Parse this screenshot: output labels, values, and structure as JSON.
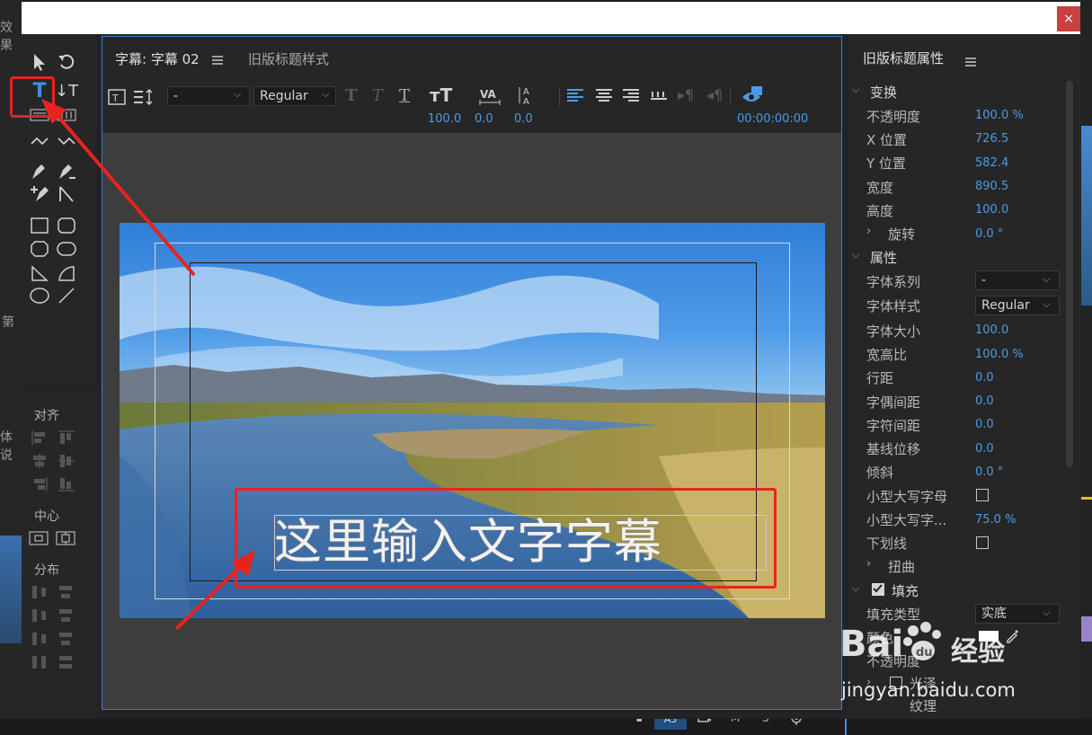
{
  "window": {
    "close_label": "×"
  },
  "background": {
    "left_tab": "效果",
    "left_tab2": "体说",
    "left_tab3": "第"
  },
  "tabs": {
    "title_tab": "字幕: 字幕 02",
    "legacy_style_tab": "旧版标题样式",
    "properties_tab": "旧版标题属性"
  },
  "toolbar": {
    "font_family": "-",
    "font_style": "Regular",
    "font_size": "100.0",
    "kerning": "0.0",
    "leading": "0.0",
    "timecode": "00:00:00:00"
  },
  "tools_panel": {
    "align_label": "对齐",
    "center_label": "中心",
    "distribute_label": "分布"
  },
  "canvas": {
    "caption_text": "这里输入文字字幕"
  },
  "properties": {
    "transform": {
      "section": "变换",
      "opacity_label": "不透明度",
      "opacity": "100.0 %",
      "x_label": "X 位置",
      "x": "726.5",
      "y_label": "Y 位置",
      "y": "582.4",
      "width_label": "宽度",
      "width": "890.5",
      "height_label": "高度",
      "height": "100.0",
      "rotation_label": "旋转",
      "rotation": "0.0 °"
    },
    "attributes": {
      "section": "属性",
      "font_family_label": "字体系列",
      "font_family": "-",
      "font_style_label": "字体样式",
      "font_style": "Regular",
      "font_size_label": "字体大小",
      "font_size": "100.0",
      "aspect_label": "宽高比",
      "aspect": "100.0 %",
      "leading_label": "行距",
      "leading": "0.0",
      "kerning_label": "字偶间距",
      "kerning": "0.0",
      "tracking_label": "字符间距",
      "tracking": "0.0",
      "baseline_label": "基线位移",
      "baseline": "0.0",
      "slant_label": "倾斜",
      "slant": "0.0 °",
      "small_caps_label": "小型大写字母",
      "small_caps_size_label": "小型大写字...",
      "small_caps_size": "75.0 %",
      "underline_label": "下划线",
      "distort_label": "扭曲"
    },
    "fill": {
      "section": "填充",
      "fill_type_label": "填充类型",
      "fill_type": "实底",
      "color_label": "颜色",
      "opacity_label": "不透明度",
      "sheen_label": "光泽",
      "texture_label": "纹理"
    }
  },
  "bottom_bar": {
    "a3": "A3",
    "m": "M",
    "s": "S"
  },
  "watermark": {
    "brand": "Bai",
    "brand2": "经验",
    "url": "jingyan.baidu.com"
  },
  "colors": {
    "accent": "#4d9be6",
    "highlight": "#e8231f"
  }
}
